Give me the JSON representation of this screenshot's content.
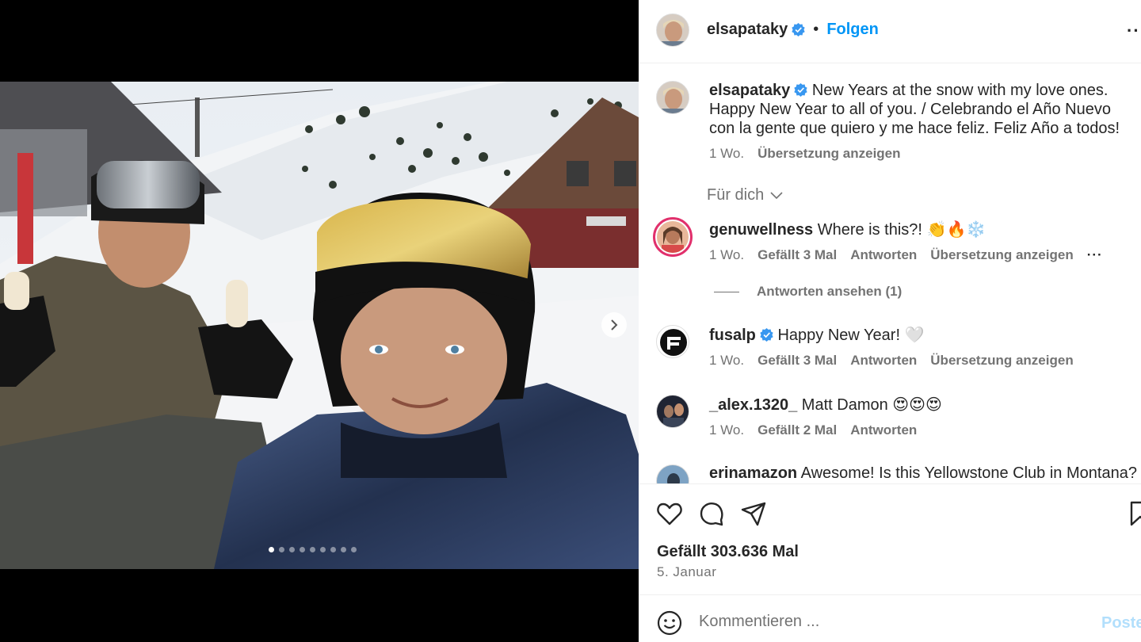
{
  "post": {
    "username": "elsapataky",
    "follow_label": "Folgen",
    "bullet": "•",
    "more": "···"
  },
  "caption": {
    "username": "elsapataky",
    "text": "New Years at the snow with my love ones. Happy New Year to all of you. / Celebrando el Año Nuevo con la gente que quiero y me hace feliz. Feliz Año a todos!",
    "time": "1 Wo.",
    "translate": "Übersetzung anzeigen"
  },
  "filter": {
    "label": "Für dich"
  },
  "comments": [
    {
      "username": "genuwellness",
      "text": "Where is this?! 👏🔥❄️",
      "time": "1 Wo.",
      "likes": "Gefällt 3 Mal",
      "reply": "Antworten",
      "translate": "Übersetzung anzeigen",
      "more": "···",
      "view_replies": "Antworten ansehen (1)"
    },
    {
      "username": "fusalp",
      "text": "Happy New Year! 🤍",
      "time": "1 Wo.",
      "likes": "Gefällt 3 Mal",
      "reply": "Antworten",
      "translate": "Übersetzung anzeigen"
    },
    {
      "username": "_alex.1320_",
      "text": "Matt Damon 😍😍😍",
      "time": "1 Wo.",
      "likes": "Gefällt 2 Mal",
      "reply": "Antworten"
    },
    {
      "username": "erinamazon",
      "text": "Awesome! Is this Yellowstone Club in Montana?"
    }
  ],
  "stats": {
    "likes": "Gefällt 303.636 Mal",
    "date": "5. Januar"
  },
  "comment_box": {
    "placeholder": "Kommentieren ...",
    "post_label": "Posten"
  },
  "carousel": {
    "total": 9,
    "active": 0
  },
  "colors": {
    "link": "#0095f6",
    "muted": "#737373",
    "text": "#262626",
    "verified": "#3897f0"
  }
}
